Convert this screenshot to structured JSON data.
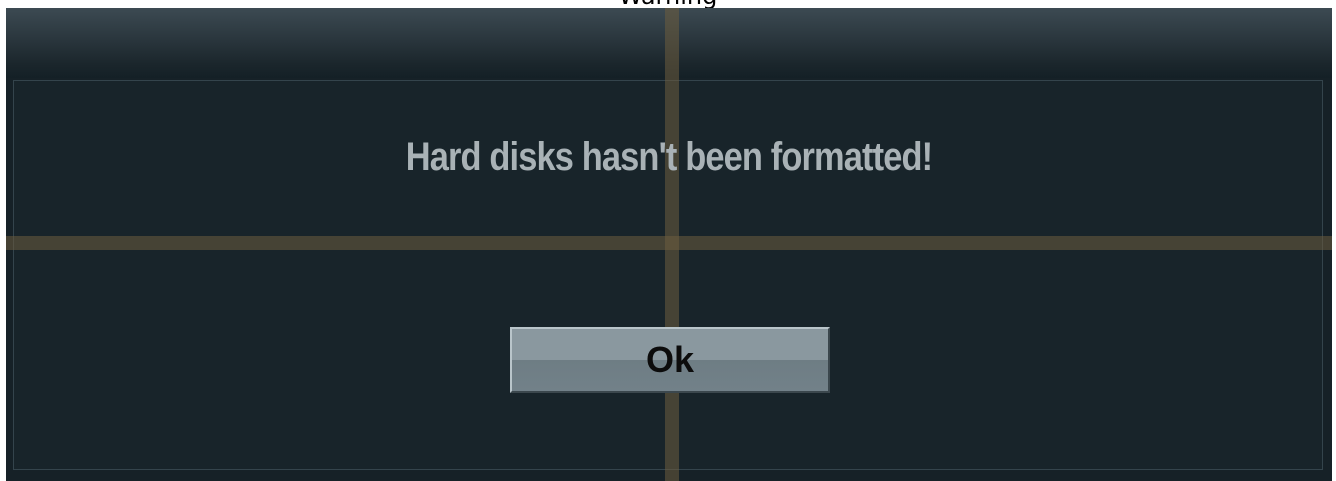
{
  "window": {
    "title": "Warning"
  },
  "dialog": {
    "message": "Hard disks hasn't been formatted!",
    "ok_label": "Ok"
  },
  "colors": {
    "dialog_background": "#162127",
    "message_text": "#a9b2b6",
    "button_face": "#8a989f",
    "crosshair": "#6e5c3e"
  }
}
